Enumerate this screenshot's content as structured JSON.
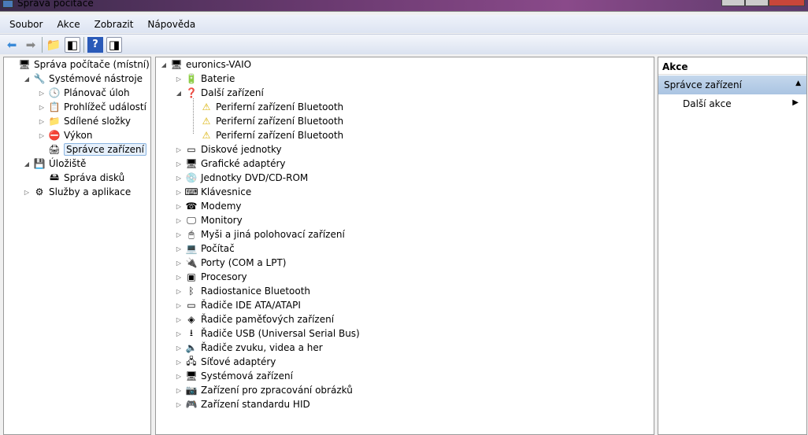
{
  "window": {
    "title": "Správa počítače"
  },
  "menu": [
    "Soubor",
    "Akce",
    "Zobrazit",
    "Nápověda"
  ],
  "left_tree": [
    {
      "label": "Správa počítače (místní)",
      "level": 0,
      "exp": "",
      "icon": "computer-management-icon",
      "glyph": "🖥"
    },
    {
      "label": "Systémové nástroje",
      "level": 1,
      "exp": "◢",
      "icon": "tools-icon",
      "glyph": "🔧"
    },
    {
      "label": "Plánovač úloh",
      "level": 2,
      "exp": "▷",
      "icon": "clock-icon",
      "glyph": "🕓"
    },
    {
      "label": "Prohlížeč událostí",
      "level": 2,
      "exp": "▷",
      "icon": "event-viewer-icon",
      "glyph": "📋"
    },
    {
      "label": "Sdílené složky",
      "level": 2,
      "exp": "▷",
      "icon": "shared-folder-icon",
      "glyph": "📁"
    },
    {
      "label": "Výkon",
      "level": 2,
      "exp": "▷",
      "icon": "performance-icon",
      "glyph": "⛔"
    },
    {
      "label": "Správce zařízení",
      "level": 2,
      "exp": "",
      "icon": "device-manager-icon",
      "glyph": "🖨",
      "selected": true
    },
    {
      "label": "Úložiště",
      "level": 1,
      "exp": "◢",
      "icon": "storage-icon",
      "glyph": "💾"
    },
    {
      "label": "Správa disků",
      "level": 2,
      "exp": "",
      "icon": "disk-icon",
      "glyph": "🖴"
    },
    {
      "label": "Služby a aplikace",
      "level": 1,
      "exp": "▷",
      "icon": "services-icon",
      "glyph": "⚙"
    }
  ],
  "device_tree": [
    {
      "label": "euronics-VAIO",
      "level": 0,
      "exp": "◢",
      "icon": "computer-icon",
      "glyph": "🖥"
    },
    {
      "label": "Baterie",
      "level": 1,
      "exp": "▷",
      "icon": "battery-icon",
      "glyph": "🔋"
    },
    {
      "label": "Další zařízení",
      "level": 1,
      "exp": "◢",
      "icon": "unknown-device-icon",
      "glyph": "❓"
    },
    {
      "label": "Periferní zařízení Bluetooth",
      "level": 2,
      "exp": "",
      "icon": "warning-icon",
      "glyph": "⚠"
    },
    {
      "label": "Periferní zařízení Bluetooth",
      "level": 2,
      "exp": "",
      "icon": "warning-icon",
      "glyph": "⚠"
    },
    {
      "label": "Periferní zařízení Bluetooth",
      "level": 2,
      "exp": "",
      "icon": "warning-icon",
      "glyph": "⚠"
    },
    {
      "label": "Diskové jednotky",
      "level": 1,
      "exp": "▷",
      "icon": "disk-drive-icon",
      "glyph": "▭"
    },
    {
      "label": "Grafické adaptéry",
      "level": 1,
      "exp": "▷",
      "icon": "display-adapter-icon",
      "glyph": "🖥"
    },
    {
      "label": "Jednotky DVD/CD-ROM",
      "level": 1,
      "exp": "▷",
      "icon": "dvd-icon",
      "glyph": "💿"
    },
    {
      "label": "Klávesnice",
      "level": 1,
      "exp": "▷",
      "icon": "keyboard-icon",
      "glyph": "⌨"
    },
    {
      "label": "Modemy",
      "level": 1,
      "exp": "▷",
      "icon": "modem-icon",
      "glyph": "☎"
    },
    {
      "label": "Monitory",
      "level": 1,
      "exp": "▷",
      "icon": "monitor-icon",
      "glyph": "🖵"
    },
    {
      "label": "Myši a jiná polohovací zařízení",
      "level": 1,
      "exp": "▷",
      "icon": "mouse-icon",
      "glyph": "🖱"
    },
    {
      "label": "Počítač",
      "level": 1,
      "exp": "▷",
      "icon": "pc-icon",
      "glyph": "💻"
    },
    {
      "label": "Porty (COM a LPT)",
      "level": 1,
      "exp": "▷",
      "icon": "port-icon",
      "glyph": "🔌"
    },
    {
      "label": "Procesory",
      "level": 1,
      "exp": "▷",
      "icon": "processor-icon",
      "glyph": "▣"
    },
    {
      "label": "Radiostanice Bluetooth",
      "level": 1,
      "exp": "▷",
      "icon": "bluetooth-icon",
      "glyph": "ᛒ"
    },
    {
      "label": "Řadiče IDE ATA/ATAPI",
      "level": 1,
      "exp": "▷",
      "icon": "ide-controller-icon",
      "glyph": "▭"
    },
    {
      "label": "Řadiče paměťových zařízení",
      "level": 1,
      "exp": "▷",
      "icon": "storage-controller-icon",
      "glyph": "◈"
    },
    {
      "label": "Řadiče USB (Universal Serial Bus)",
      "level": 1,
      "exp": "▷",
      "icon": "usb-icon",
      "glyph": "⭳"
    },
    {
      "label": "Řadiče zvuku, videa a her",
      "level": 1,
      "exp": "▷",
      "icon": "sound-icon",
      "glyph": "🔈"
    },
    {
      "label": "Síťové adaptéry",
      "level": 1,
      "exp": "▷",
      "icon": "network-adapter-icon",
      "glyph": "🖧"
    },
    {
      "label": "Systémová zařízení",
      "level": 1,
      "exp": "▷",
      "icon": "system-device-icon",
      "glyph": "🖥"
    },
    {
      "label": "Zařízení pro zpracování obrázků",
      "level": 1,
      "exp": "▷",
      "icon": "imaging-device-icon",
      "glyph": "📷"
    },
    {
      "label": "Zařízení standardu HID",
      "level": 1,
      "exp": "▷",
      "icon": "hid-icon",
      "glyph": "🎮"
    }
  ],
  "actions": {
    "header": "Akce",
    "section": "Správce zařízení",
    "item": "Další akce"
  }
}
